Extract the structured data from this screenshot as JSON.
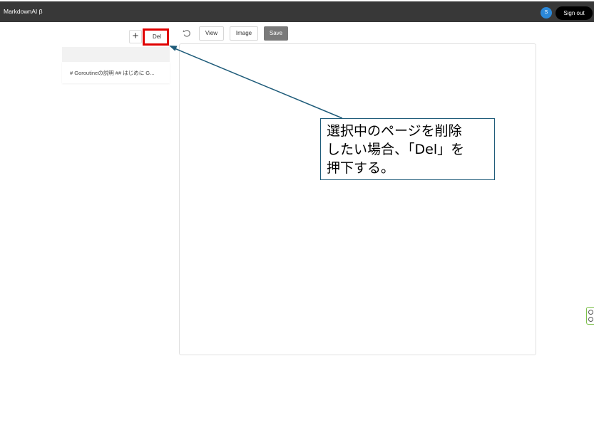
{
  "header": {
    "app_title": "MarkdownAI β",
    "avatar_initial": "S",
    "signout_label": "Sign out"
  },
  "toolbar": {
    "add_label": "+",
    "del_label": "Del",
    "view_label": "View",
    "image_label": "Image",
    "save_label": "Save"
  },
  "sidebar": {
    "items": [
      {
        "label": "# Goroutineの説明 ## はじめに G..."
      }
    ]
  },
  "callout": {
    "lines": [
      "選択中のページを削除",
      "したい場合、「Del」を",
      "押下する。"
    ]
  },
  "colors": {
    "header_bg": "#383838",
    "highlight": "#e00000",
    "arrow": "#1f5c7a",
    "save_bg": "#7a7a7a",
    "avatar": "#2b88d8"
  }
}
